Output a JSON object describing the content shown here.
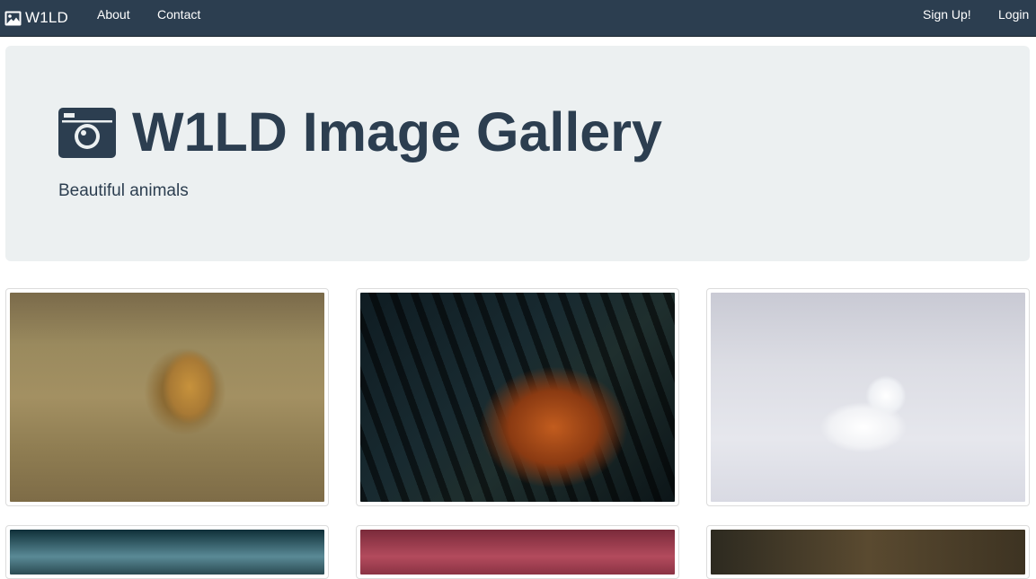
{
  "navbar": {
    "brand": "W1LD",
    "brand_icon": "image-icon",
    "links": {
      "about": "About",
      "contact": "Contact",
      "signup": "Sign Up!",
      "login": "Login"
    }
  },
  "hero": {
    "icon": "camera-icon",
    "title": "W1LD Image Gallery",
    "subtitle": "Beautiful animals"
  },
  "gallery": [
    {
      "subject": "lion"
    },
    {
      "subject": "tiger"
    },
    {
      "subject": "arctic fox"
    },
    {
      "subject": "partially visible"
    },
    {
      "subject": "partially visible"
    },
    {
      "subject": "partially visible"
    }
  ],
  "colors": {
    "navbar_bg": "#2c3e50",
    "jumbotron_bg": "#ecf0f1",
    "text": "#2c3e50"
  }
}
